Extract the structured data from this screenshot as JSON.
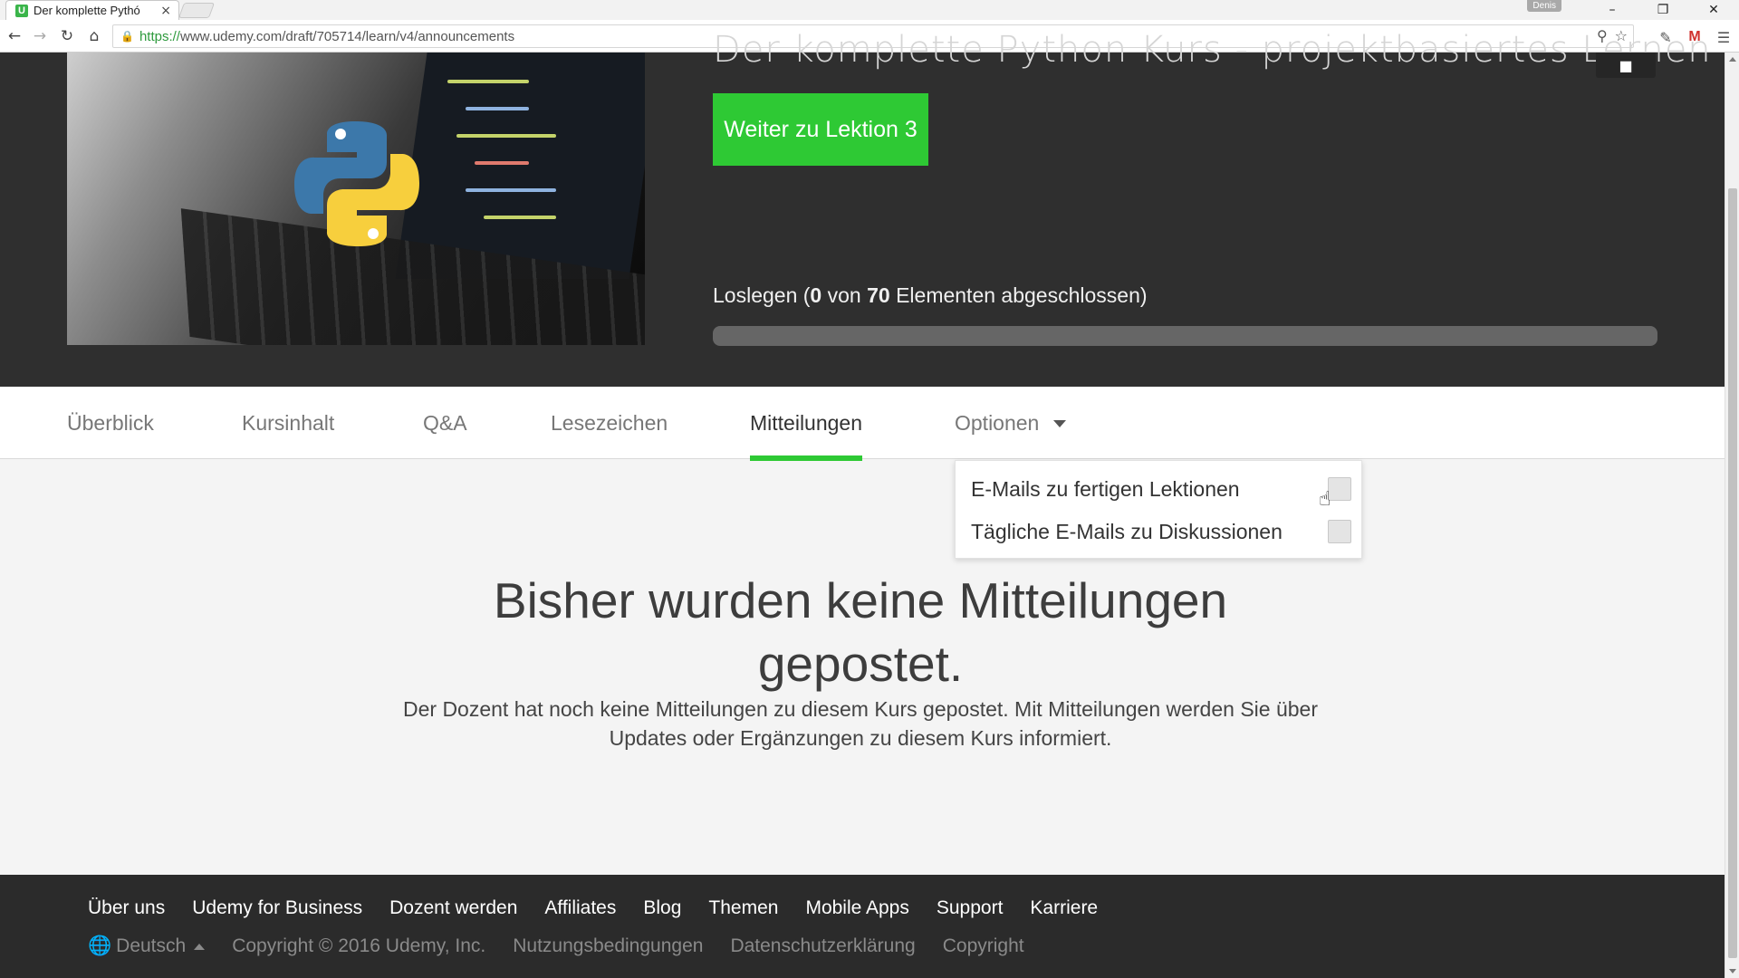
{
  "browser": {
    "tab_title": "Der komplette Pythó",
    "tab_close": "×",
    "profile_name": "Denis",
    "url_scheme": "https://",
    "url_rest": "www.udemy.com/draft/705714/learn/v4/announcements"
  },
  "hero": {
    "course_title": "Der komplette Python Kurs - projektbasiertes Lernen",
    "continue_button": "Weiter zu Lektion 3",
    "progress_prefix": "Loslegen (",
    "progress_done": "0",
    "progress_mid": " von ",
    "progress_total": "70",
    "progress_suffix": " Elementen abgeschlossen)",
    "progress_fraction": 0
  },
  "tabs": [
    {
      "label": "Überblick"
    },
    {
      "label": "Kursinhalt"
    },
    {
      "label": "Q&A"
    },
    {
      "label": "Lesezeichen"
    },
    {
      "label": "Mitteilungen"
    },
    {
      "label": "Optionen"
    }
  ],
  "options_menu": {
    "items": [
      {
        "label": "E-Mails zu fertigen Lektionen",
        "checked": false
      },
      {
        "label": "Tägliche E-Mails zu Diskussionen",
        "checked": false
      }
    ]
  },
  "empty_state": {
    "title": "Bisher wurden keine Mitteilungen gepostet.",
    "description": "Der Dozent hat noch keine Mitteilungen zu diesem Kurs gepostet. Mit Mitteilungen werden Sie über Updates oder Ergänzungen zu diesem Kurs informiert."
  },
  "footer": {
    "links": [
      "Über uns",
      "Udemy for Business",
      "Dozent werden",
      "Affiliates",
      "Blog",
      "Themen",
      "Mobile Apps",
      "Support",
      "Karriere"
    ],
    "language": "Deutsch",
    "copyright": "Copyright © 2016 Udemy, Inc.",
    "terms": "Nutzungsbedingungen",
    "privacy": "Datenschutzerklärung",
    "copyright_link": "Copyright"
  },
  "colors": {
    "brand_green": "#2ec934",
    "hero_bg": "#2f2f2f",
    "footer_bg": "#2b2b2b"
  }
}
